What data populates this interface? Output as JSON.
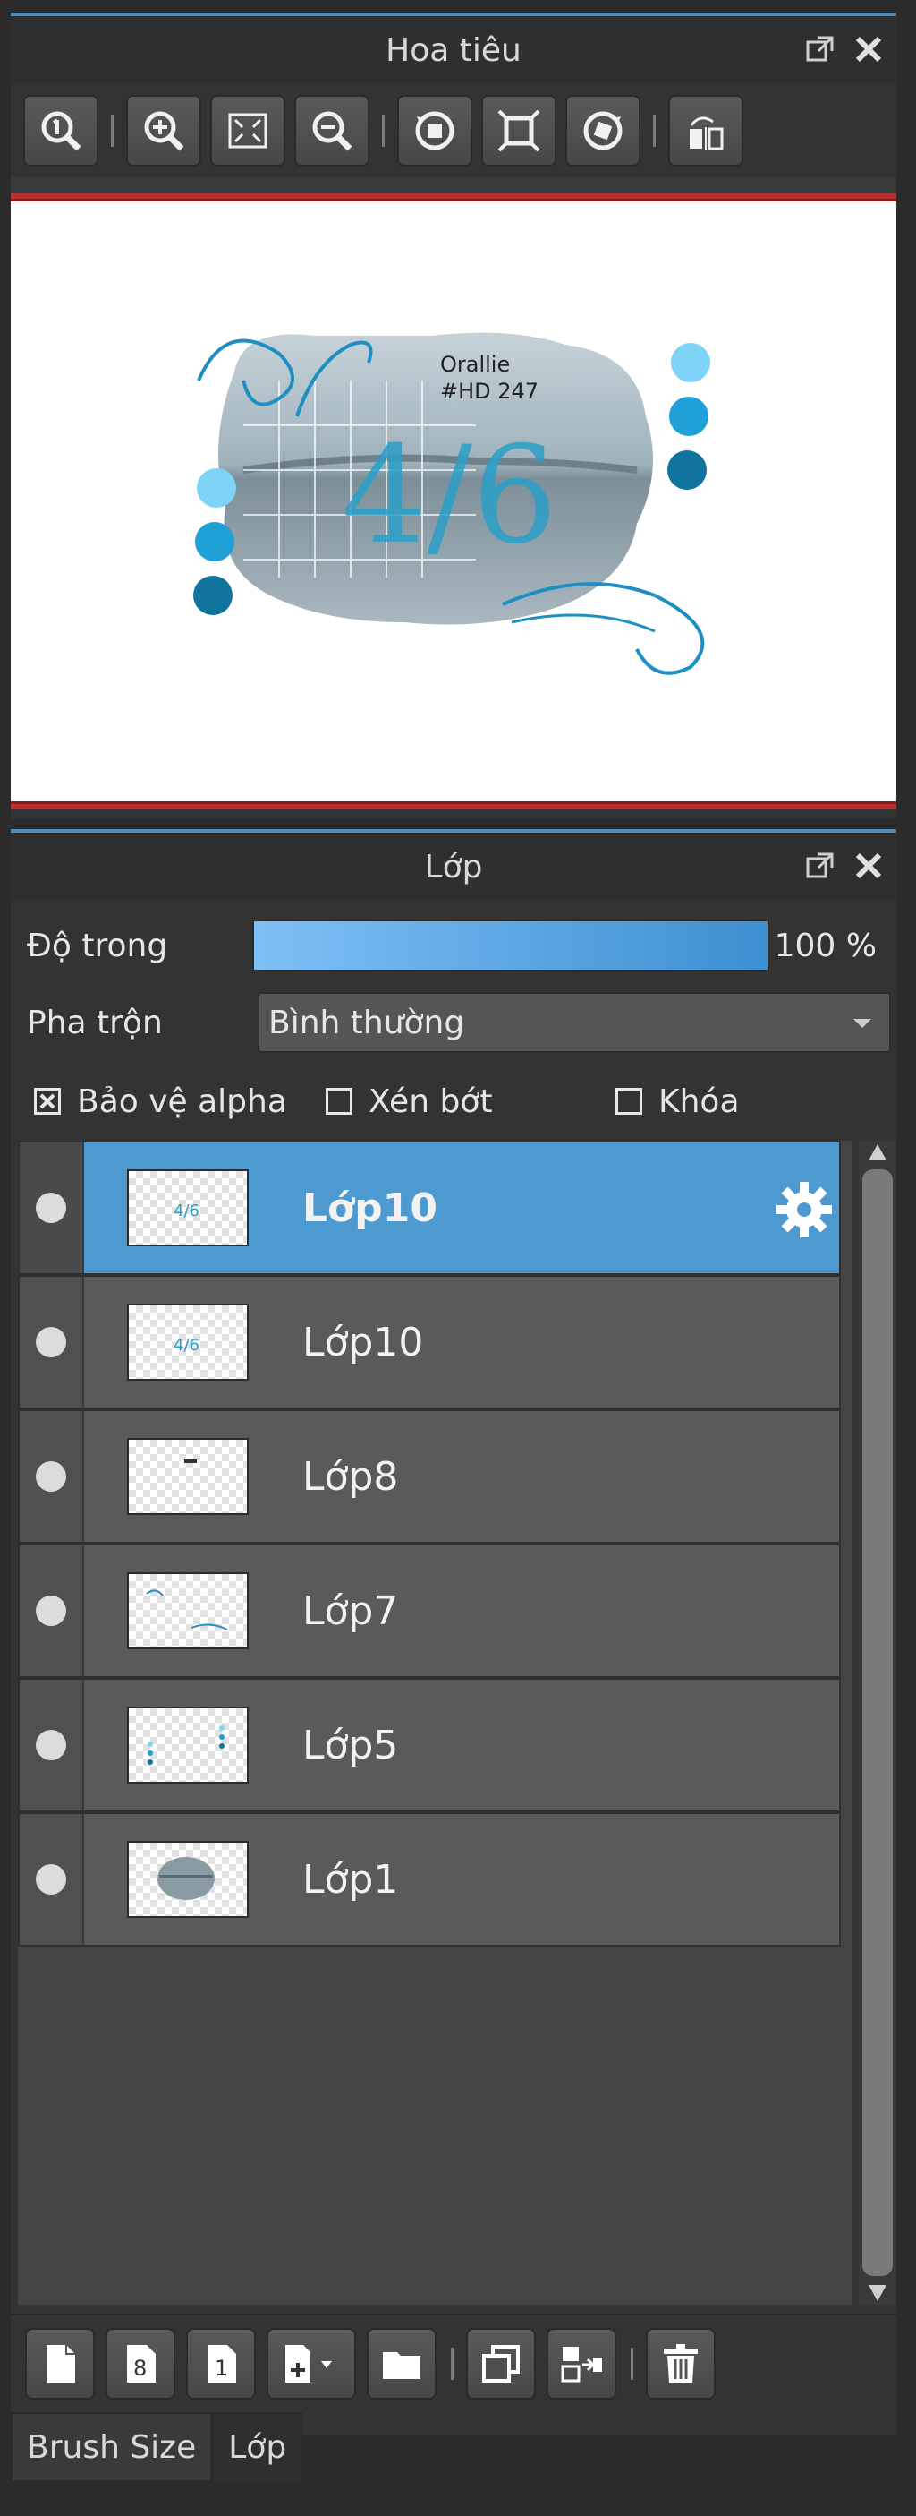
{
  "navigator": {
    "title": "Hoa tiêu",
    "toolbar": [
      {
        "icon": "zoom-actual-icon"
      },
      {
        "icon": "zoom-in-icon"
      },
      {
        "icon": "fit-screen-icon"
      },
      {
        "icon": "zoom-out-icon"
      },
      {
        "icon": "rotate-left-icon"
      },
      {
        "icon": "fit-canvas-icon"
      },
      {
        "icon": "rotate-right-icon"
      },
      {
        "icon": "flip-horizontal-icon"
      }
    ],
    "canvas_text": [
      "Orallie",
      "#HD 247",
      "4/6"
    ],
    "accent_colors": [
      "#7fd3f6",
      "#1fa0d6",
      "#10749e"
    ]
  },
  "layers": {
    "title": "Lớp",
    "opacity_label": "Độ trong",
    "opacity_value": "100 %",
    "opacity_fraction": 1.0,
    "blend_label": "Pha trộn",
    "blend_value": "Bình thường",
    "options": {
      "protect_alpha": {
        "label": "Bảo vệ alpha",
        "checked": true
      },
      "clipping": {
        "label": "Xén bớt",
        "checked": false
      },
      "lock": {
        "label": "Khóa",
        "checked": false
      }
    },
    "items": [
      {
        "name": "Lớp10",
        "selected": true
      },
      {
        "name": "Lớp10",
        "selected": false
      },
      {
        "name": "Lớp8",
        "selected": false
      },
      {
        "name": "Lớp7",
        "selected": false
      },
      {
        "name": "Lớp5",
        "selected": false
      },
      {
        "name": "Lớp1",
        "selected": false
      }
    ],
    "bottom_toolbar": [
      {
        "icon": "new-layer-icon"
      },
      {
        "icon": "new-8bit-layer-icon"
      },
      {
        "icon": "new-1bit-layer-icon"
      },
      {
        "icon": "add-layer-menu-icon"
      },
      {
        "icon": "folder-icon"
      },
      {
        "icon": "duplicate-layer-icon"
      },
      {
        "icon": "merge-down-icon"
      },
      {
        "icon": "delete-layer-icon"
      }
    ]
  },
  "tabs": [
    {
      "label": "Brush Size",
      "active": false
    },
    {
      "label": "Lớp",
      "active": true
    }
  ],
  "colors": {
    "selection": "#4d9ad1",
    "panel_bg": "#333333",
    "accent": "#4f8fc0"
  }
}
